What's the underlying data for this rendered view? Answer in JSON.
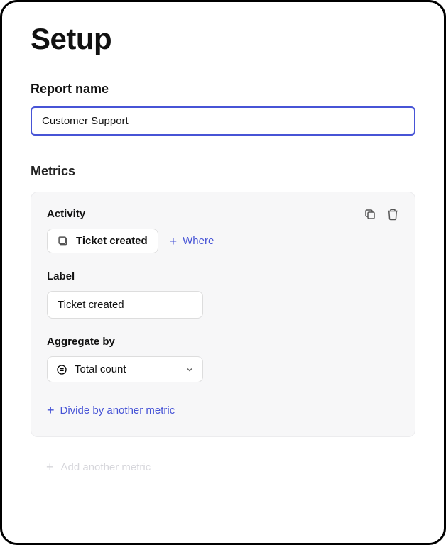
{
  "page": {
    "title": "Setup"
  },
  "reportName": {
    "label": "Report name",
    "value": "Customer Support "
  },
  "metrics": {
    "heading": "Metrics",
    "card": {
      "activity": {
        "label": "Activity",
        "chip": "Ticket created",
        "whereLink": "Where"
      },
      "label": {
        "label": "Label",
        "value": "Ticket created"
      },
      "aggregate": {
        "label": "Aggregate by",
        "selected": "Total count"
      },
      "divideLink": "Divide by another metric"
    },
    "addMetricLink": "Add another metric"
  }
}
